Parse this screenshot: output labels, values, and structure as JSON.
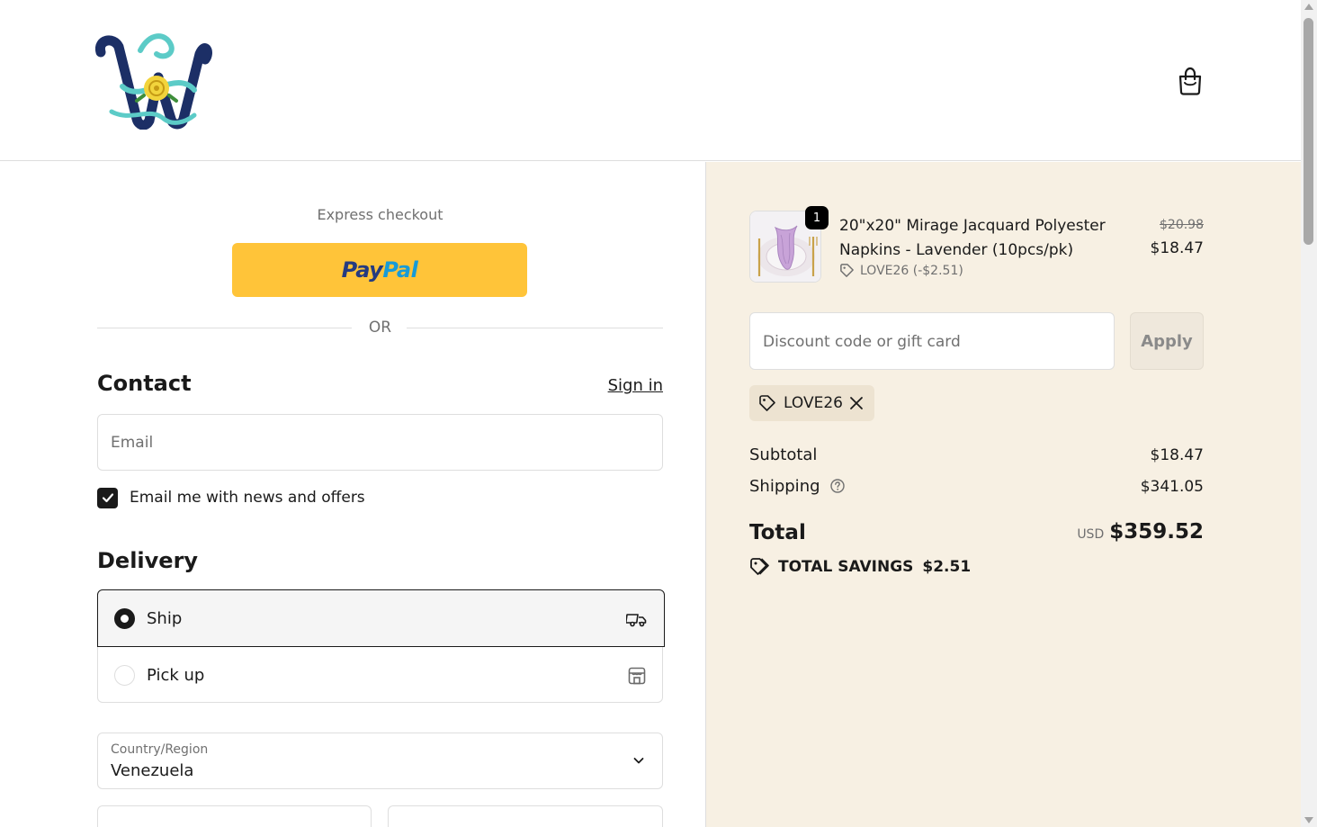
{
  "header": {
    "logo_icon": "monogram-logo",
    "cart_icon": "shopping-bag-icon"
  },
  "express": {
    "title": "Express checkout",
    "paypal_a": "Pay",
    "paypal_b": "Pal",
    "paypal_color": "#ffc439",
    "or_text": "OR"
  },
  "contact": {
    "heading": "Contact",
    "sign_in": "Sign in",
    "email_placeholder": "Email",
    "newsletter_label": "Email me with news and offers",
    "newsletter_checked": true
  },
  "delivery": {
    "heading": "Delivery",
    "options": [
      {
        "label": "Ship",
        "selected": true,
        "icon": "truck-icon"
      },
      {
        "label": "Pick up",
        "selected": false,
        "icon": "store-icon"
      }
    ],
    "country_label": "Country/Region",
    "country_value": "Venezuela"
  },
  "summary": {
    "item": {
      "quantity": "1",
      "name": "20\"x20\" Mirage Jacquard Polyester Napkins - Lavender (10pcs/pk)",
      "discount": "LOVE26 (-$2.51)",
      "price_original": "$20.98",
      "price_current": "$18.47"
    },
    "discount_placeholder": "Discount code or gift card",
    "apply_label": "Apply",
    "applied_code": "LOVE26",
    "subtotal_label": "Subtotal",
    "subtotal_value": "$18.47",
    "shipping_label": "Shipping",
    "shipping_value": "$341.05",
    "total_label": "Total",
    "total_currency": "USD",
    "total_value": "$359.52",
    "savings_label": "TOTAL SAVINGS",
    "savings_value": "$2.51",
    "panel_color": "#f7f0e3"
  }
}
